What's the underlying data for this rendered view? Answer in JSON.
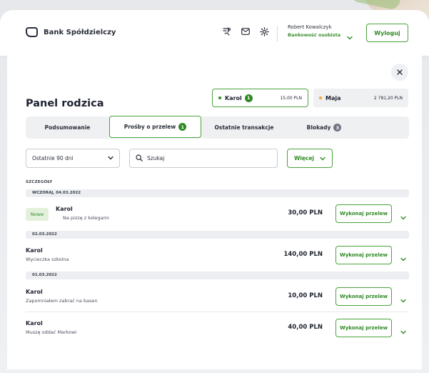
{
  "header": {
    "brand": "Bank Spółdzielczy",
    "user_name": "Robert Kowalczyk",
    "user_account": "Bankowość osobista",
    "logout_label": "Wyloguj"
  },
  "panel": {
    "title": "Panel rodzica",
    "children": [
      {
        "name": "Karol",
        "badge": "1",
        "amount": "15,00 PLN",
        "dot_color": "#2f8a24"
      },
      {
        "name": "Maja",
        "amount": "2 781,20 PLN",
        "dot_color": "#f2a43a"
      }
    ],
    "tabs": [
      {
        "label": "Podsumowanie"
      },
      {
        "label": "Prośby o przelew",
        "badge": "1"
      },
      {
        "label": "Ostatnie transakcje"
      },
      {
        "label": "Blokady",
        "badge": "3"
      }
    ],
    "filter_period": "Ostatnie 90 dni",
    "search_placeholder": "Szukaj",
    "more_label": "Więcej",
    "section_label": "SZCZEGÓŁY",
    "dates": [
      "WCZORAJ, 04.03.2022",
      "02.03.2022",
      "01.03.2022"
    ],
    "requests": [
      {
        "tag": "Nowe",
        "name": "Karol",
        "desc": "Na pizzę z kolegami",
        "amount": "30,00 PLN",
        "action": "Wykonaj przelew"
      },
      {
        "name": "Karol",
        "desc": "Wycieczka szkolna",
        "amount": "140,00 PLN",
        "action": "Wykonaj przelew"
      },
      {
        "name": "Karol",
        "desc": "Zapomniałem zabrać na basen",
        "amount": "10,00 PLN",
        "action": "Wykonaj przelew"
      },
      {
        "name": "Karol",
        "desc": "Muszę oddać Markowi",
        "amount": "40,00 PLN",
        "action": "Wykonaj przelew"
      }
    ]
  },
  "colors": {
    "accent": "#4aa33b",
    "accent_text": "#2f8a24",
    "background": "#ebedef"
  },
  "icons": {
    "brand": "bank-logo-icon",
    "transfer": "money-transfer-icon",
    "mail": "mail-icon",
    "settings": "gear-icon",
    "close": "close-icon",
    "search": "search-icon",
    "chevron": "chevron-down-icon"
  }
}
